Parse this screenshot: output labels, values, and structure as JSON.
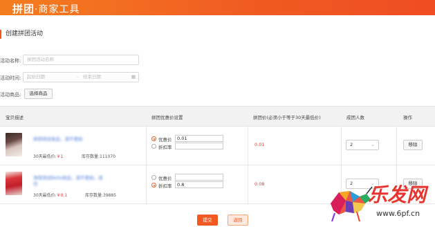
{
  "header": {
    "brand_main": "拼团",
    "brand_sub": "·商家工具"
  },
  "page_title": "创建拼团活动",
  "form": {
    "name_label": "活动名称:",
    "name_placeholder": "拼团活动名称",
    "time_label": "活动时间:",
    "start_placeholder": "起始日期",
    "separator": "-",
    "end_placeholder": "结束日期",
    "product_label": "活动商品:",
    "select_product_button": "选择商品"
  },
  "table": {
    "headers": [
      "宝贝描述",
      "拼团优惠价设置",
      "拼团价(必须小于等于30天最低价)",
      "成团人数",
      "操作"
    ],
    "rows": [
      {
        "name_line1": "拼团测试商品，请不要拍",
        "name_line2": "",
        "lowest_label": "30天最低价:",
        "lowest_value": "￥1",
        "stock_label": "库存数量:",
        "stock_value": "111070",
        "opt1_label": "优惠价",
        "opt1_value": "0.01",
        "opt2_label": "折扣率",
        "opt2_value": "",
        "selected": "opt1",
        "group_price": "0.01",
        "group_size": "2",
        "remove_label": "移除"
      },
      {
        "name_line1": "净雨测试Bella商品，请不要拍，请",
        "name_line2": "勿",
        "lowest_label": "30天最低价:",
        "lowest_value": "￥0.1",
        "stock_label": "库存数量:",
        "stock_value": "39885",
        "opt1_label": "优惠价",
        "opt1_value": "",
        "opt2_label": "折扣率",
        "opt2_value": "0.8",
        "selected": "opt2",
        "group_price": "0.08",
        "group_size": "2",
        "remove_label": "移除"
      }
    ]
  },
  "actions": {
    "submit": "提交",
    "back": "返回"
  },
  "watermark": {
    "text": "乐发网",
    "url": "www.6pf.cn"
  },
  "colors": {
    "brand": "#f05a22",
    "price": "#e33333",
    "link": "#4a7cd8"
  }
}
